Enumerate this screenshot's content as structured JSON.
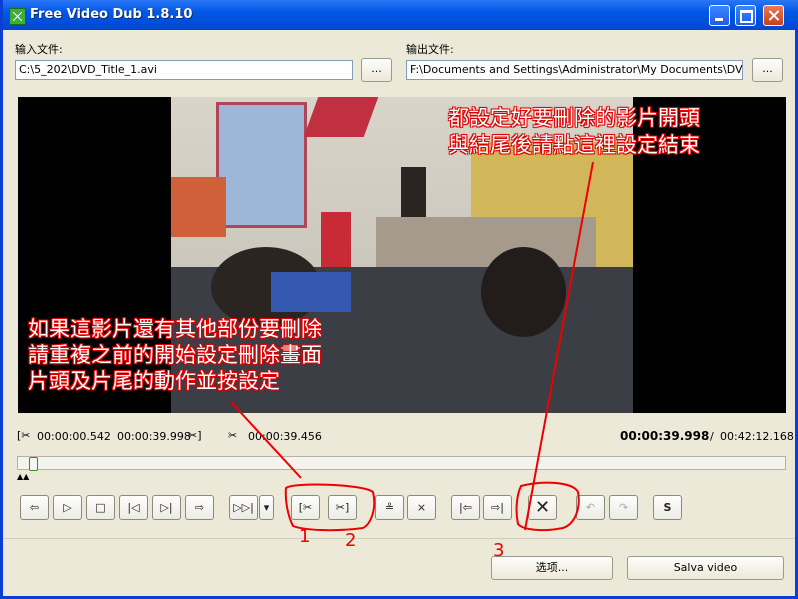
{
  "window": {
    "title": "Free Video Dub 1.8.10"
  },
  "input": {
    "label": "输入文件:",
    "value": "C:\\5_202\\DVD_Title_1.avi",
    "browse_label": "..."
  },
  "output": {
    "label": "输出文件:",
    "value": "F:\\Documents and Settings\\Administrator\\My Documents\\DVDVideoSoft",
    "browse_label": "..."
  },
  "annotations": {
    "top_line1": "都設定好要刪除的影片開頭",
    "top_line2": "與結尾後請點這裡設定結束",
    "mid_line1": "如果這影片還有其他部份要刪除",
    "mid_line2": "請重複之前的開始設定刪除畫面",
    "mid_line3": "片頭及片尾的動作並按設定",
    "num1": "1",
    "num2": "2",
    "num3": "3"
  },
  "times": {
    "start": "00:00:00.542",
    "end": "00:00:39.998",
    "cut": "00:00:39.456",
    "current": "00:00:39.998",
    "total": "00:42:12.168"
  },
  "slider": {
    "position_fraction": 0.016
  },
  "controls": {
    "prev_frame": "⇦",
    "play": "▷",
    "stop": "□",
    "go_start": "|◁",
    "go_end": "▷|",
    "next_frame": "⇨",
    "play_range": "▷▷|",
    "dropdown": "▾",
    "mark_start": "[✂",
    "mark_end": "✂]",
    "mark_both": "≗",
    "clear_marks": "⨯",
    "prev_mark": "|⇦",
    "next_mark": "⇨|",
    "delete_selection": "✕",
    "undo": "↶",
    "redo": "↷",
    "save_frame": "S"
  },
  "buttons": {
    "options": "选项...",
    "save": "Salva video"
  }
}
